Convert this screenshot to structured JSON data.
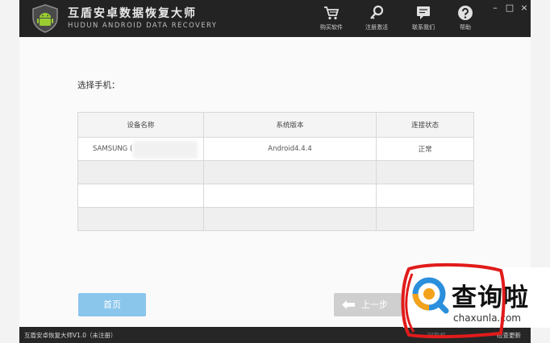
{
  "app": {
    "title": "互盾安卓数据恢复大师",
    "subtitle": "HUDUN ANDROID DATA RECOVERY"
  },
  "toolbar": {
    "buy_label": "购买软件",
    "register_label": "注册激活",
    "contact_label": "联系我们",
    "help_label": "帮助"
  },
  "window_controls": {
    "minimize": "–",
    "maximize": "□",
    "close": "×"
  },
  "main": {
    "prompt": "选择手机：",
    "table": {
      "headers": [
        "设备名称",
        "系统版本",
        "连接状态"
      ],
      "rows": [
        [
          "SAMSUNG (",
          "Android4.4.4",
          "正常"
        ],
        [
          "",
          "",
          ""
        ],
        [
          "",
          "",
          ""
        ],
        [
          "",
          "",
          ""
        ]
      ]
    }
  },
  "buttons": {
    "home": "首页",
    "prev": "上一步"
  },
  "status": {
    "version": "互盾安卓恢复大师V1.0（未注册）",
    "faded": "回复邮",
    "update": "检查更新"
  },
  "watermark": {
    "title": "查询啦",
    "domain": "chaxunla.com"
  },
  "colors": {
    "titlebar": "#232323",
    "home_button": "#8ac5ec",
    "prev_button": "#cfcfcf",
    "watermark_blue": "#2a8fdc",
    "watermark_orange": "#f3a21b",
    "red_mark": "#e11b1b"
  }
}
